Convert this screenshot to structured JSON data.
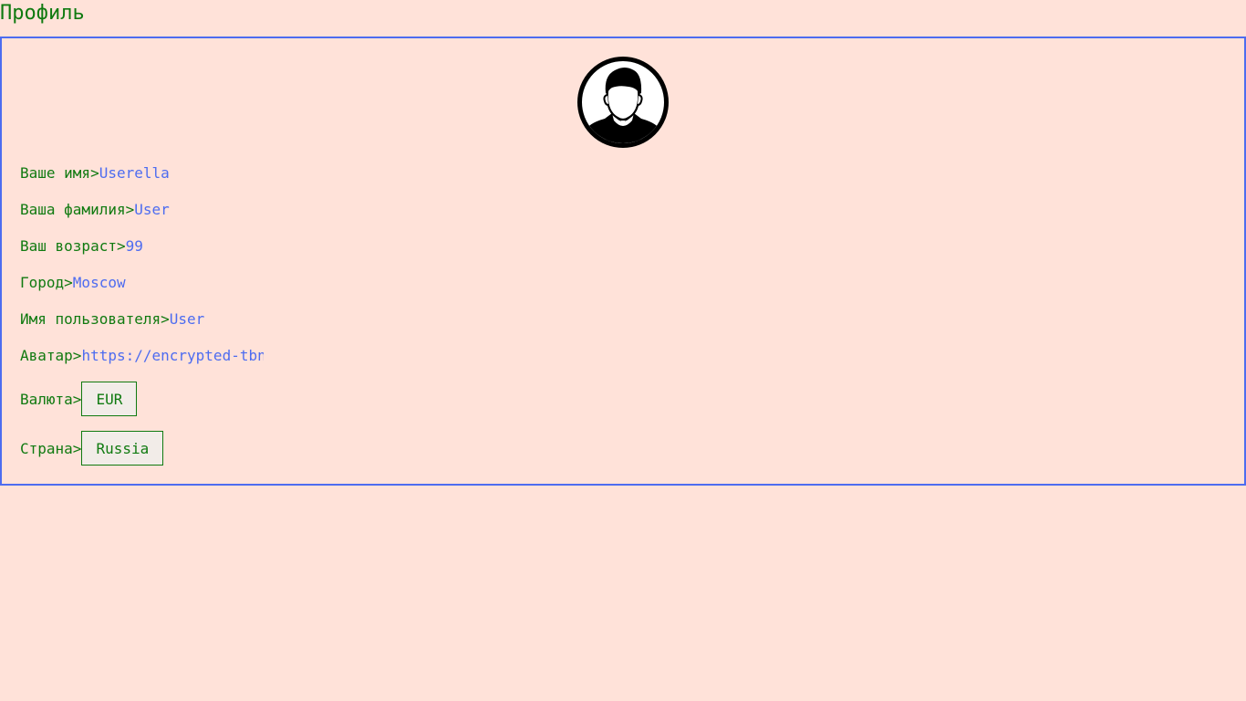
{
  "page": {
    "title": "Профиль"
  },
  "avatar": {
    "icon": "user-avatar-icon"
  },
  "fields": {
    "first_name": {
      "label": "Ваше имя>",
      "value": "Userella"
    },
    "last_name": {
      "label": "Ваша фамилия>",
      "value": "User"
    },
    "age": {
      "label": "Ваш возраст>",
      "value": "99"
    },
    "city": {
      "label": "Город>",
      "value": "Moscow"
    },
    "username": {
      "label": "Имя пользователя>",
      "value": "User"
    },
    "avatar_url": {
      "label": "Аватар>",
      "value": "https://encrypted-tbn"
    }
  },
  "selects": {
    "currency": {
      "label": "Валюта>",
      "value": "EUR"
    },
    "country": {
      "label": "Страна>",
      "value": "Russia"
    }
  },
  "colors": {
    "background": "#ffe2d9",
    "label": "#107a10",
    "value": "#4d6cf0",
    "border": "#4d6cf0"
  }
}
